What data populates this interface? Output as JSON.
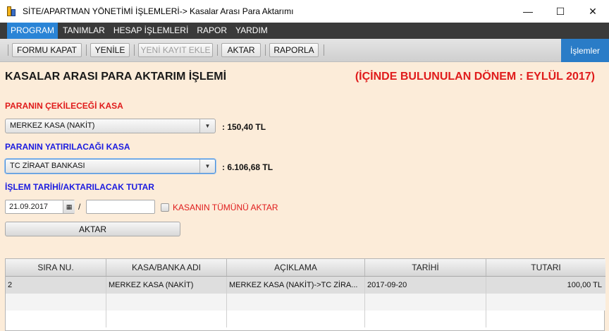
{
  "window": {
    "title": "SİTE/APARTMAN YÖNETİMİ İŞLEMLERİ-> Kasalar Arası Para Aktarımı",
    "controls": {
      "minimize": "—",
      "maximize": "☐",
      "close": "✕"
    }
  },
  "menu": [
    "PROGRAM",
    "TANIMLAR",
    "HESAP İŞLEMLERİ",
    "RAPOR",
    "YARDIM"
  ],
  "toolbar": {
    "close_form": "FORMU KAPAT",
    "refresh": "YENİLE",
    "new_record": "YENİ KAYIT EKLE",
    "transfer": "AKTAR",
    "report": "RAPORLA",
    "operations": "İşlemler"
  },
  "page": {
    "title": "KASALAR ARASI PARA AKTARIM İŞLEMİ",
    "period": "(İÇİNDE BULUNULAN DÖNEM : EYLÜL 2017)"
  },
  "source": {
    "label": "PARANIN ÇEKİLECEĞİ KASA",
    "selected": "MERKEZ KASA (NAKİT)",
    "balance": ":   150,40 TL"
  },
  "target": {
    "label": "PARANIN YATIRILACAĞI KASA",
    "selected": "TC ZİRAAT BANKASI",
    "balance": ":   6.106,68 TL"
  },
  "transfer": {
    "label": "İŞLEM TARİHİ/AKTARILACAK TUTAR",
    "date": "21.09.2017",
    "separator": "/",
    "amount": "",
    "transfer_all_label": "KASANIN TÜMÜNÜ AKTAR",
    "transfer_all_checked": false,
    "button": "AKTAR"
  },
  "table": {
    "columns": [
      "SIRA NU.",
      "KASA/BANKA ADI",
      "AÇIKLAMA",
      "TARİHİ",
      "TUTARI"
    ],
    "rows": [
      [
        "2",
        "MERKEZ KASA (NAKİT)",
        "MERKEZ KASA (NAKİT)->TC ZİRA...",
        "2017-09-20",
        "100,00 TL"
      ]
    ]
  },
  "colors": {
    "accent": "#2a84d6",
    "heading_red": "#e01b1b",
    "heading_blue": "#1b1be0",
    "background": "#fcecd9"
  }
}
